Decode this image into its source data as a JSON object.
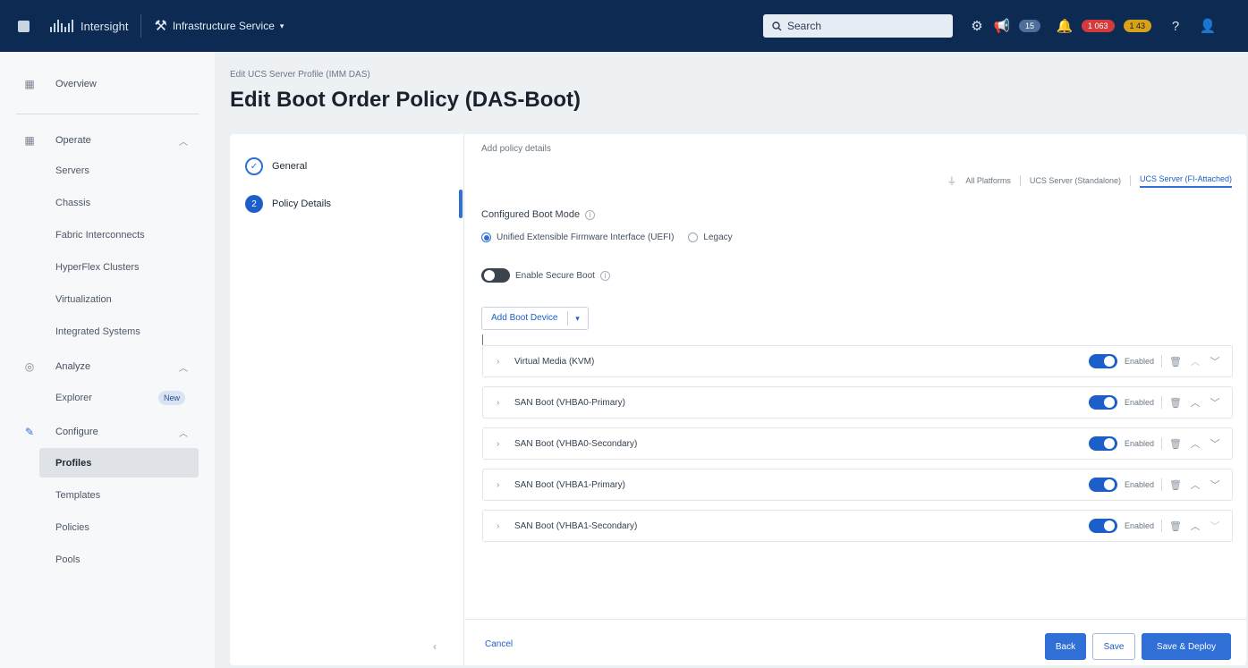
{
  "topbar": {
    "brand": "Intersight",
    "service": "Infrastructure Service",
    "search_label": "Search",
    "messages_count": "15",
    "alarms_critical": "1 063",
    "alarms_warning": "1 43"
  },
  "sidebar": {
    "overview": "Overview",
    "operate": "Operate",
    "operate_items": [
      "Servers",
      "Chassis",
      "Fabric Interconnects",
      "HyperFlex Clusters",
      "Virtualization",
      "Integrated Systems"
    ],
    "analyze": "Analyze",
    "explorer": "Explorer",
    "new_badge": "New",
    "configure": "Configure",
    "configure_items": [
      "Profiles",
      "Templates",
      "Policies",
      "Pools"
    ]
  },
  "header": {
    "breadcrumb": "Edit UCS Server Profile (IMM DAS)",
    "title": "Edit Boot Order Policy (DAS-Boot)"
  },
  "steps": [
    {
      "label": "General",
      "number": ""
    },
    {
      "label": "Policy Details",
      "number": "2"
    }
  ],
  "policy": {
    "subtitle": "Add policy details",
    "filters": [
      "All Platforms",
      "UCS Server (Standalone)",
      "UCS Server (FI-Attached)"
    ],
    "boot_mode_label": "Configured Boot Mode",
    "boot_mode_options": [
      "Unified Extensible Firmware Interface (UEFI)",
      "Legacy"
    ],
    "secure_boot_label": "Enable Secure Boot",
    "add_device_label": "Add Boot Device",
    "enabled_label": "Enabled",
    "devices": [
      "Virtual Media (KVM)",
      "SAN Boot (VHBA0-Primary)",
      "SAN Boot (VHBA0-Secondary)",
      "SAN Boot (VHBA1-Primary)",
      "SAN Boot (VHBA1-Secondary)"
    ]
  },
  "footer": {
    "cancel": "Cancel",
    "back": "Back",
    "save": "Save",
    "save_deploy": "Save & Deploy"
  }
}
